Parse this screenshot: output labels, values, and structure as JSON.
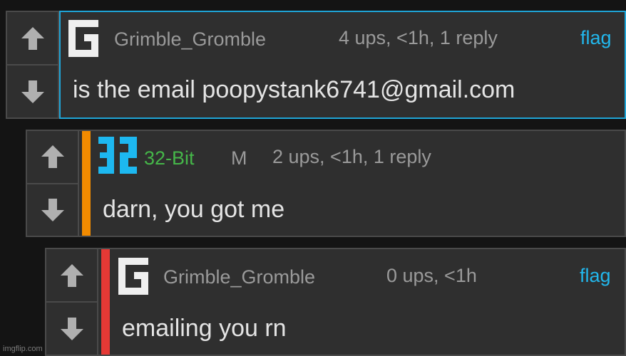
{
  "colors": {
    "background": "#141414",
    "panel": "#2f2f2f",
    "border": "#4a4a4a",
    "accent": "#22b7ec",
    "thread_orange": "#f28b00",
    "thread_red": "#e53935",
    "green": "#45b649",
    "text": "#e4e4e4",
    "muted": "#9a9a9a"
  },
  "comments": [
    {
      "username": "Grimble_Gromble",
      "meta": "4 ups, <1h, 1 reply",
      "flag": "flag",
      "text": "is the email poopystank6741@gmail.com",
      "avatar_icon": "g-avatar-icon"
    },
    {
      "username": "32-Bit",
      "badge": "M",
      "meta": "2 ups, <1h, 1 reply",
      "text": "darn, you got me",
      "avatar_icon": "32-avatar-icon"
    },
    {
      "username": "Grimble_Gromble",
      "meta": "0 ups, <1h",
      "flag": "flag",
      "text": "emailing you rn",
      "avatar_icon": "g-avatar-icon"
    }
  ],
  "watermark": "imgflip.com"
}
